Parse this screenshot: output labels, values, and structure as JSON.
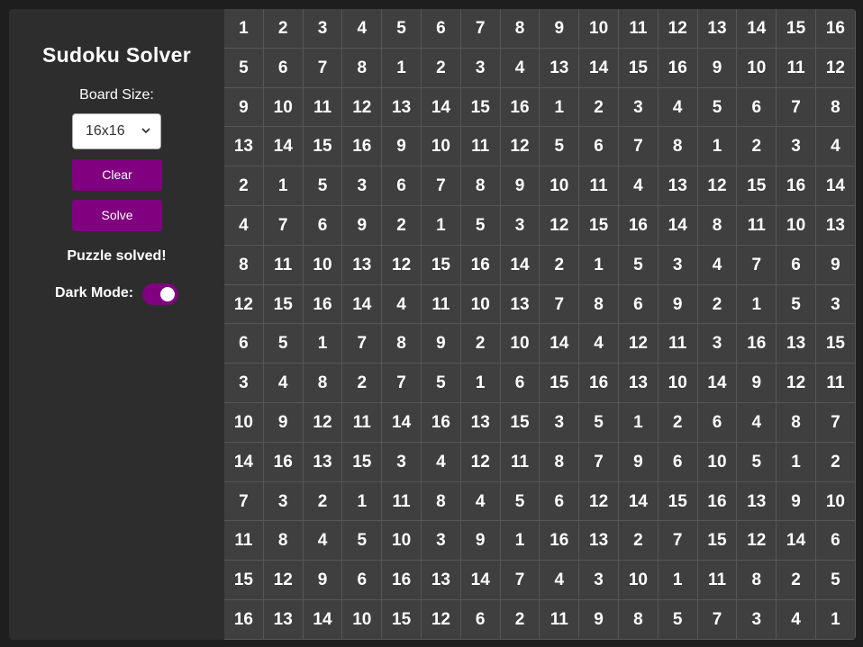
{
  "app": {
    "title": "Sudoku Solver",
    "board_size_label": "Board Size:",
    "board_size_value": "16x16",
    "clear_label": "Clear",
    "solve_label": "Solve",
    "status": "Puzzle solved!",
    "dark_mode_label": "Dark Mode:",
    "dark_mode_on": true
  },
  "icons": {
    "select_arrow": "chevron-down-icon"
  },
  "colors": {
    "accent": "#800080",
    "background": "#1e1e1e",
    "panel": "#2d2d2d",
    "board": "#3f3f3f",
    "text": "#ffffff"
  },
  "board": [
    [
      1,
      2,
      3,
      4,
      5,
      6,
      7,
      8,
      9,
      10,
      11,
      12,
      13,
      14,
      15,
      16
    ],
    [
      5,
      6,
      7,
      8,
      1,
      2,
      3,
      4,
      13,
      14,
      15,
      16,
      9,
      10,
      11,
      12
    ],
    [
      9,
      10,
      11,
      12,
      13,
      14,
      15,
      16,
      1,
      2,
      3,
      4,
      5,
      6,
      7,
      8
    ],
    [
      13,
      14,
      15,
      16,
      9,
      10,
      11,
      12,
      5,
      6,
      7,
      8,
      1,
      2,
      3,
      4
    ],
    [
      2,
      1,
      5,
      3,
      6,
      7,
      8,
      9,
      10,
      11,
      4,
      13,
      12,
      15,
      16,
      14
    ],
    [
      4,
      7,
      6,
      9,
      2,
      1,
      5,
      3,
      12,
      15,
      16,
      14,
      8,
      11,
      10,
      13
    ],
    [
      8,
      11,
      10,
      13,
      12,
      15,
      16,
      14,
      2,
      1,
      5,
      3,
      4,
      7,
      6,
      9
    ],
    [
      12,
      15,
      16,
      14,
      4,
      11,
      10,
      13,
      7,
      8,
      6,
      9,
      2,
      1,
      5,
      3
    ],
    [
      6,
      5,
      1,
      7,
      8,
      9,
      2,
      10,
      14,
      4,
      12,
      11,
      3,
      16,
      13,
      15
    ],
    [
      3,
      4,
      8,
      2,
      7,
      5,
      1,
      6,
      15,
      16,
      13,
      10,
      14,
      9,
      12,
      11
    ],
    [
      10,
      9,
      12,
      11,
      14,
      16,
      13,
      15,
      3,
      5,
      1,
      2,
      6,
      4,
      8,
      7
    ],
    [
      14,
      16,
      13,
      15,
      3,
      4,
      12,
      11,
      8,
      7,
      9,
      6,
      10,
      5,
      1,
      2
    ],
    [
      7,
      3,
      2,
      1,
      11,
      8,
      4,
      5,
      6,
      12,
      14,
      15,
      16,
      13,
      9,
      10
    ],
    [
      11,
      8,
      4,
      5,
      10,
      3,
      9,
      1,
      16,
      13,
      2,
      7,
      15,
      12,
      14,
      6
    ],
    [
      15,
      12,
      9,
      6,
      16,
      13,
      14,
      7,
      4,
      3,
      10,
      1,
      11,
      8,
      2,
      5
    ],
    [
      16,
      13,
      14,
      10,
      15,
      12,
      6,
      2,
      11,
      9,
      8,
      5,
      7,
      3,
      4,
      1
    ]
  ]
}
